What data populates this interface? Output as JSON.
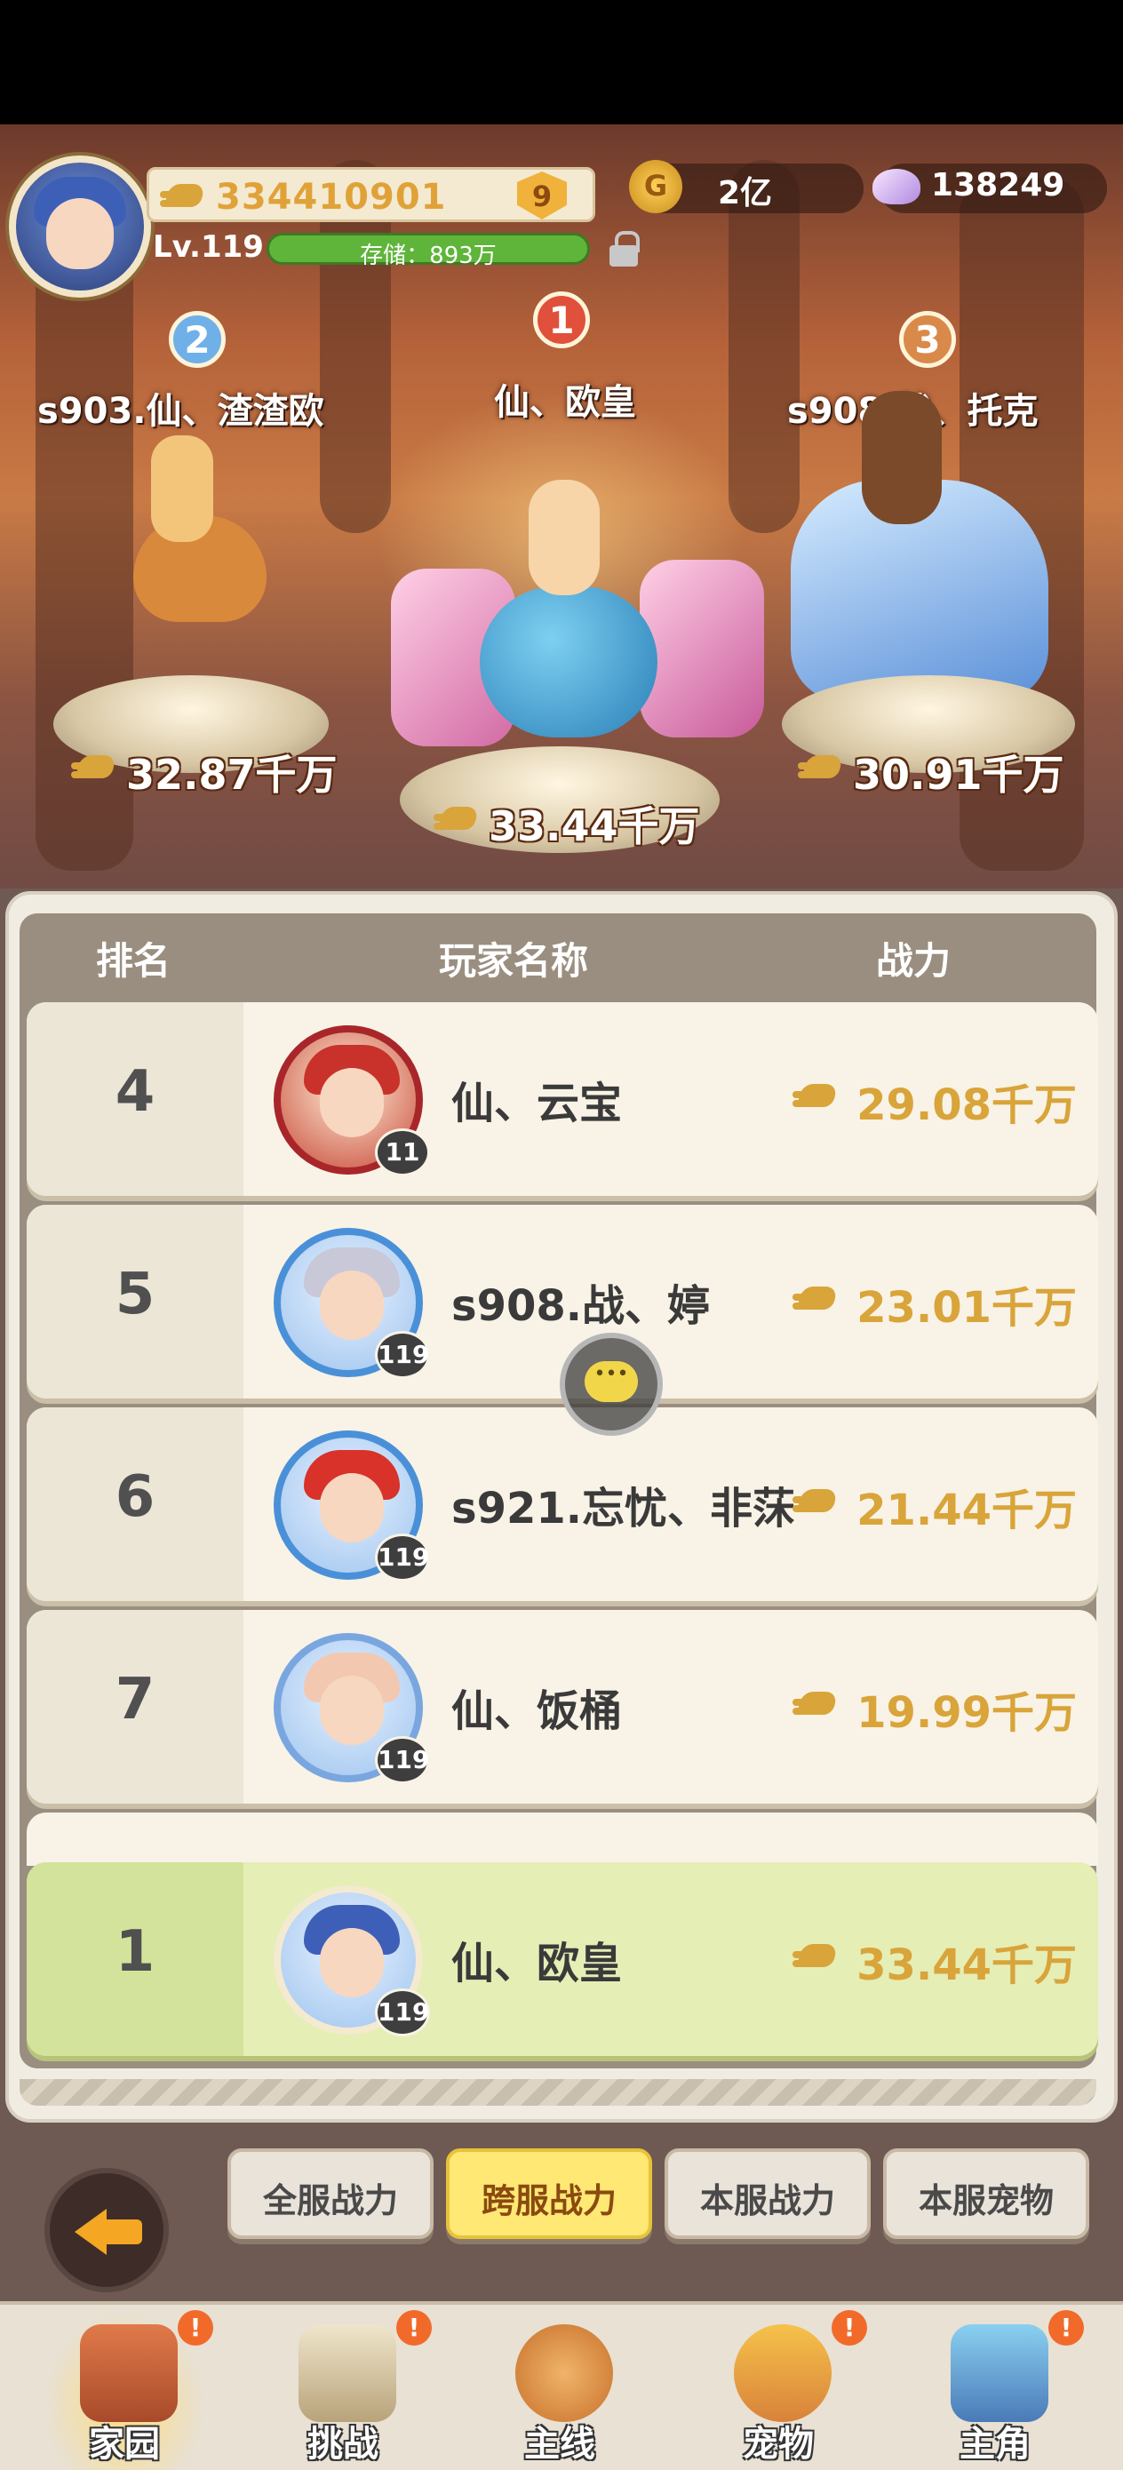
{
  "hud": {
    "power": "334410901",
    "vip_level": "9",
    "level": "Lv.119",
    "storage": "存储：893万",
    "gold": "2亿",
    "gems": "138249"
  },
  "podium": [
    {
      "rank": "2",
      "name": "s903.仙、渣渣欧",
      "power": "32.87千万"
    },
    {
      "rank": "1",
      "name": "仙、欧皇",
      "power": "33.44千万"
    },
    {
      "rank": "3",
      "name": "s908.战、托克",
      "power": "30.91千万"
    }
  ],
  "table_header": {
    "rank": "排名",
    "name": "玩家名称",
    "power": "战力"
  },
  "rows": [
    {
      "rank": "4",
      "name": "仙、云宝",
      "level": "11",
      "power": "29.08千万"
    },
    {
      "rank": "5",
      "name": "s908.战、婷",
      "level": "119",
      "power": "23.01千万"
    },
    {
      "rank": "6",
      "name": "s921.忘忧、非莯",
      "level": "119",
      "power": "21.44千万"
    },
    {
      "rank": "7",
      "name": "仙、饭桶",
      "level": "119",
      "power": "19.99千万"
    }
  ],
  "my_row": {
    "rank": "1",
    "name": "仙、欧皇",
    "level": "119",
    "power": "33.44千万"
  },
  "tabs": [
    "全服战力",
    "跨服战力",
    "本服战力",
    "本服宠物"
  ],
  "active_tab": "跨服战力",
  "nav": [
    {
      "label": "家园",
      "alert": "!"
    },
    {
      "label": "挑战",
      "alert": "!"
    },
    {
      "label": "主线",
      "alert": ""
    },
    {
      "label": "宠物",
      "alert": "!"
    },
    {
      "label": "主角",
      "alert": "!"
    }
  ],
  "colors": {
    "power_gold": "#d9a43a",
    "active_tab": "#ffe873",
    "my_row": "#e5eeb5",
    "alert": "#f26a2a"
  }
}
